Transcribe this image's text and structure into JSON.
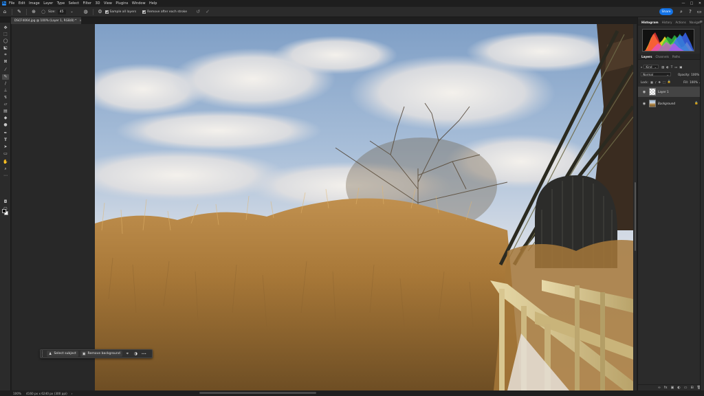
{
  "app": {
    "logo": "Ps",
    "menu": [
      "File",
      "Edit",
      "Image",
      "Layer",
      "Type",
      "Select",
      "Filter",
      "3D",
      "View",
      "Plugins",
      "Window",
      "Help"
    ],
    "window_controls": [
      "—",
      "□",
      "✕"
    ]
  },
  "options_bar": {
    "size_label": "Size:",
    "size_value": "45",
    "sample_all_layers_label": "Sample all layers",
    "sample_all_layers_checked": true,
    "remove_after_stroke_label": "Remove after each stroke",
    "remove_after_stroke_checked": true,
    "share_label": "Share"
  },
  "document": {
    "tab_title": "DSCF4064.jpg @ 100% (Layer 1, RGB/8) *",
    "tab_close": "×",
    "zoom": "100%",
    "info": "4160 px x 6240 px (300 ppi)",
    "status_arrow": "›"
  },
  "contextual_bar": {
    "select_subject_label": "Select subject",
    "remove_background_label": "Remove background",
    "more_glyph": "•••"
  },
  "panels": {
    "top_tabs": [
      "Histogram",
      "History",
      "Actions",
      "Navigat"
    ],
    "top_tabs_active": 0,
    "menu_glyph": "≡",
    "layer_tabs": [
      "Layers",
      "Channels",
      "Paths"
    ],
    "layer_tabs_active": 0,
    "kind_label": "Kind",
    "blend_mode": "Normal",
    "opacity_label": "Opacity:",
    "opacity_value": "100%",
    "lock_label": "Lock:",
    "fill_label": "Fill:",
    "fill_value": "100%",
    "layers": [
      {
        "name": "Layer 1",
        "selected": true,
        "locked": false
      },
      {
        "name": "Background",
        "selected": false,
        "locked": true
      }
    ],
    "footer_icons": [
      "fx",
      "◐",
      "▣",
      "▭",
      "⊞",
      "🗑"
    ]
  },
  "colors": {
    "accent_blue": "#1473e6",
    "panel_bg": "#2b2b2b",
    "app_bg": "#1e1e1e"
  }
}
